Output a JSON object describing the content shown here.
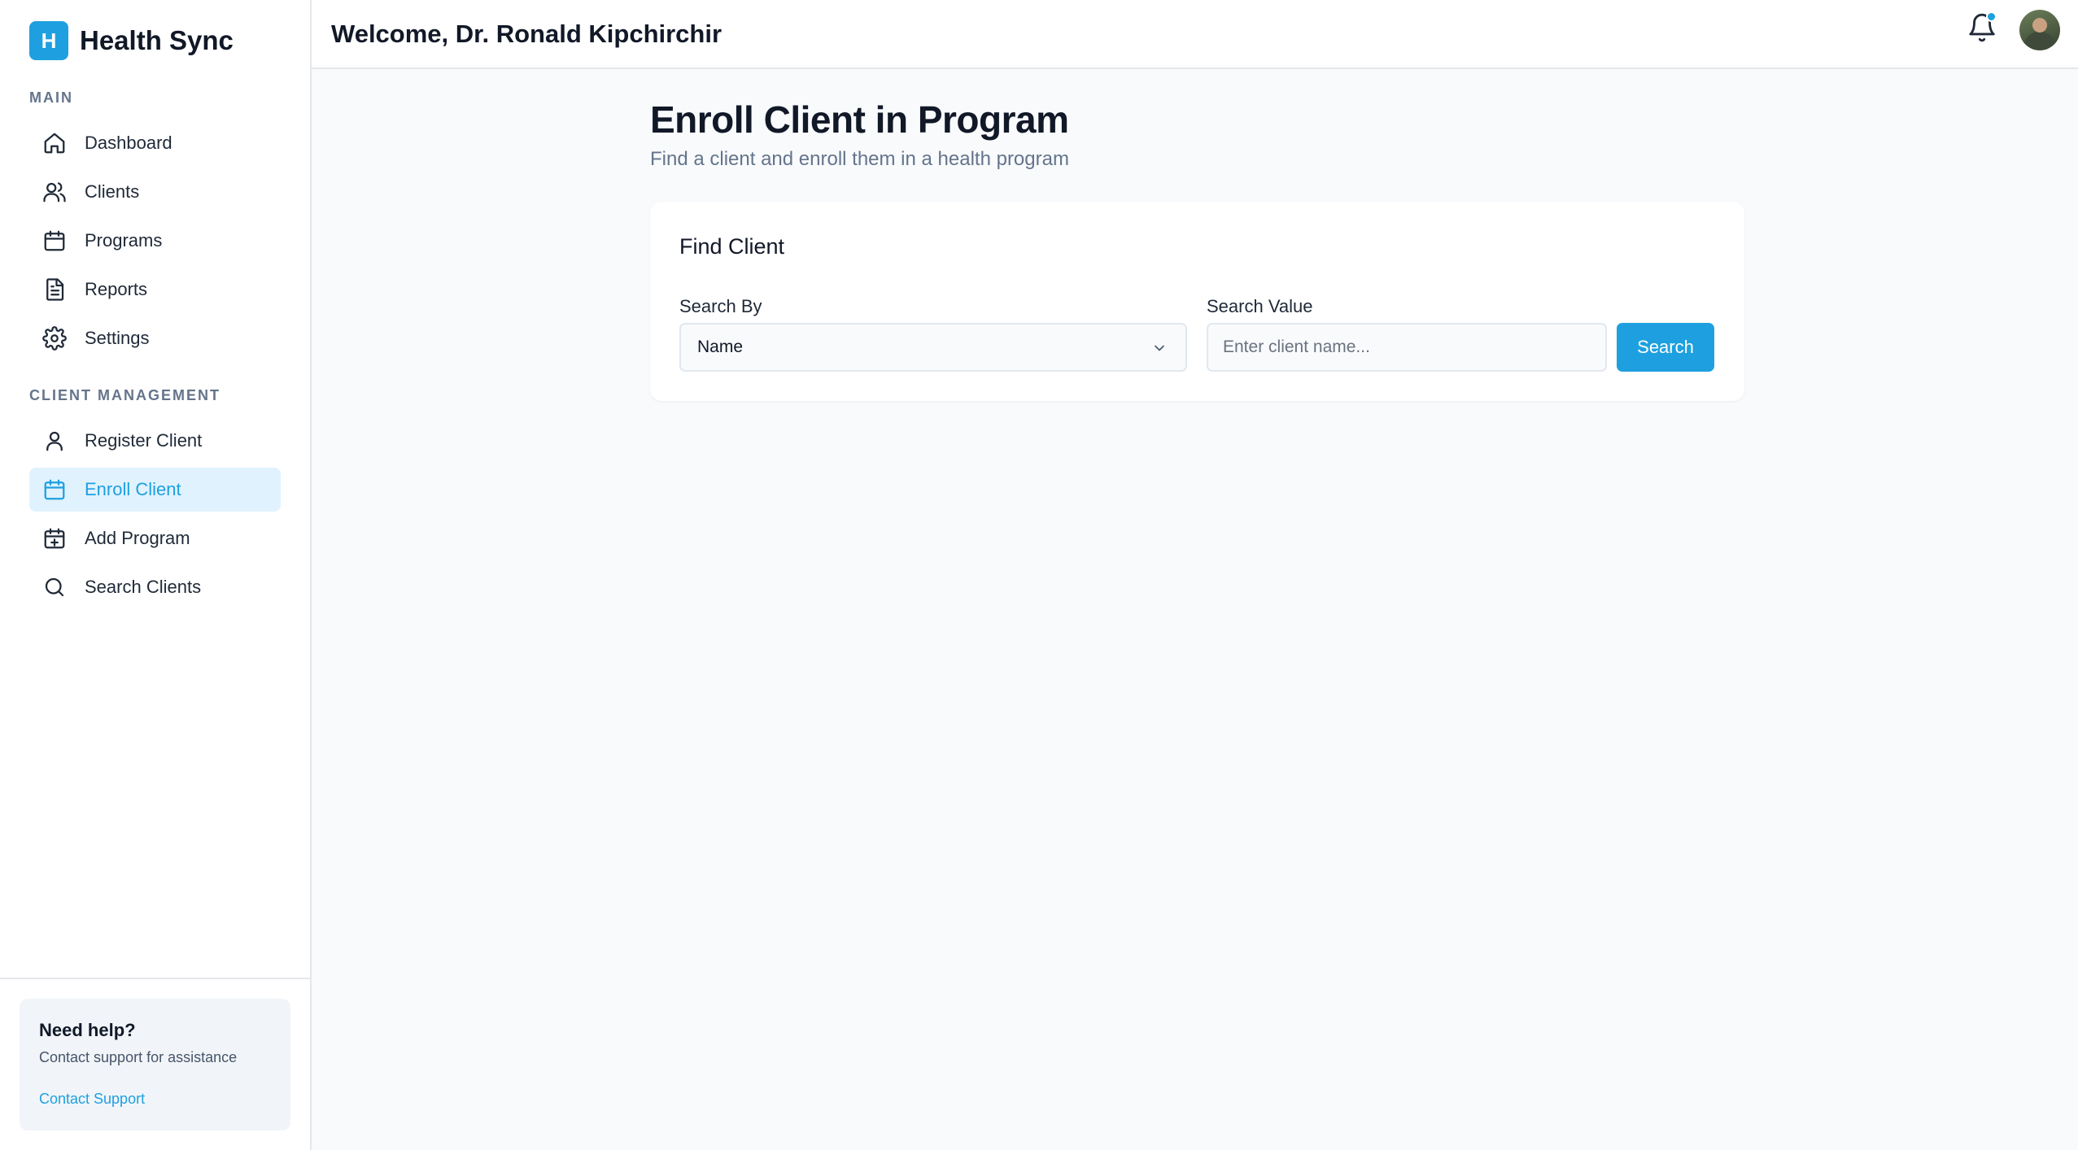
{
  "brand": {
    "logo_letter": "H",
    "name": "Health Sync",
    "accent": "#1ea0e0"
  },
  "sidebar": {
    "main_title": "MAIN",
    "main_items": [
      {
        "label": "Dashboard",
        "icon": "home-icon"
      },
      {
        "label": "Clients",
        "icon": "users-icon"
      },
      {
        "label": "Programs",
        "icon": "calendar-icon"
      },
      {
        "label": "Reports",
        "icon": "document-icon"
      },
      {
        "label": "Settings",
        "icon": "gear-icon"
      }
    ],
    "client_title": "CLIENT MANAGEMENT",
    "client_items": [
      {
        "label": "Register Client",
        "icon": "user-icon"
      },
      {
        "label": "Enroll Client",
        "icon": "calendar-icon",
        "active": true
      },
      {
        "label": "Add Program",
        "icon": "calendar-plus-icon"
      },
      {
        "label": "Search Clients",
        "icon": "search-icon"
      }
    ],
    "help": {
      "title": "Need help?",
      "subtitle": "Contact support for assistance",
      "link": "Contact Support"
    }
  },
  "header": {
    "welcome": "Welcome, Dr. Ronald Kipchirchir",
    "notification_icon": "bell-icon",
    "has_unread": true
  },
  "page": {
    "title": "Enroll Client in Program",
    "subtitle": "Find a client and enroll them in a health program"
  },
  "find_client": {
    "title": "Find Client",
    "search_by_label": "Search By",
    "search_by_value": "Name",
    "search_value_label": "Search Value",
    "search_value_placeholder": "Enter client name...",
    "search_button": "Search"
  }
}
